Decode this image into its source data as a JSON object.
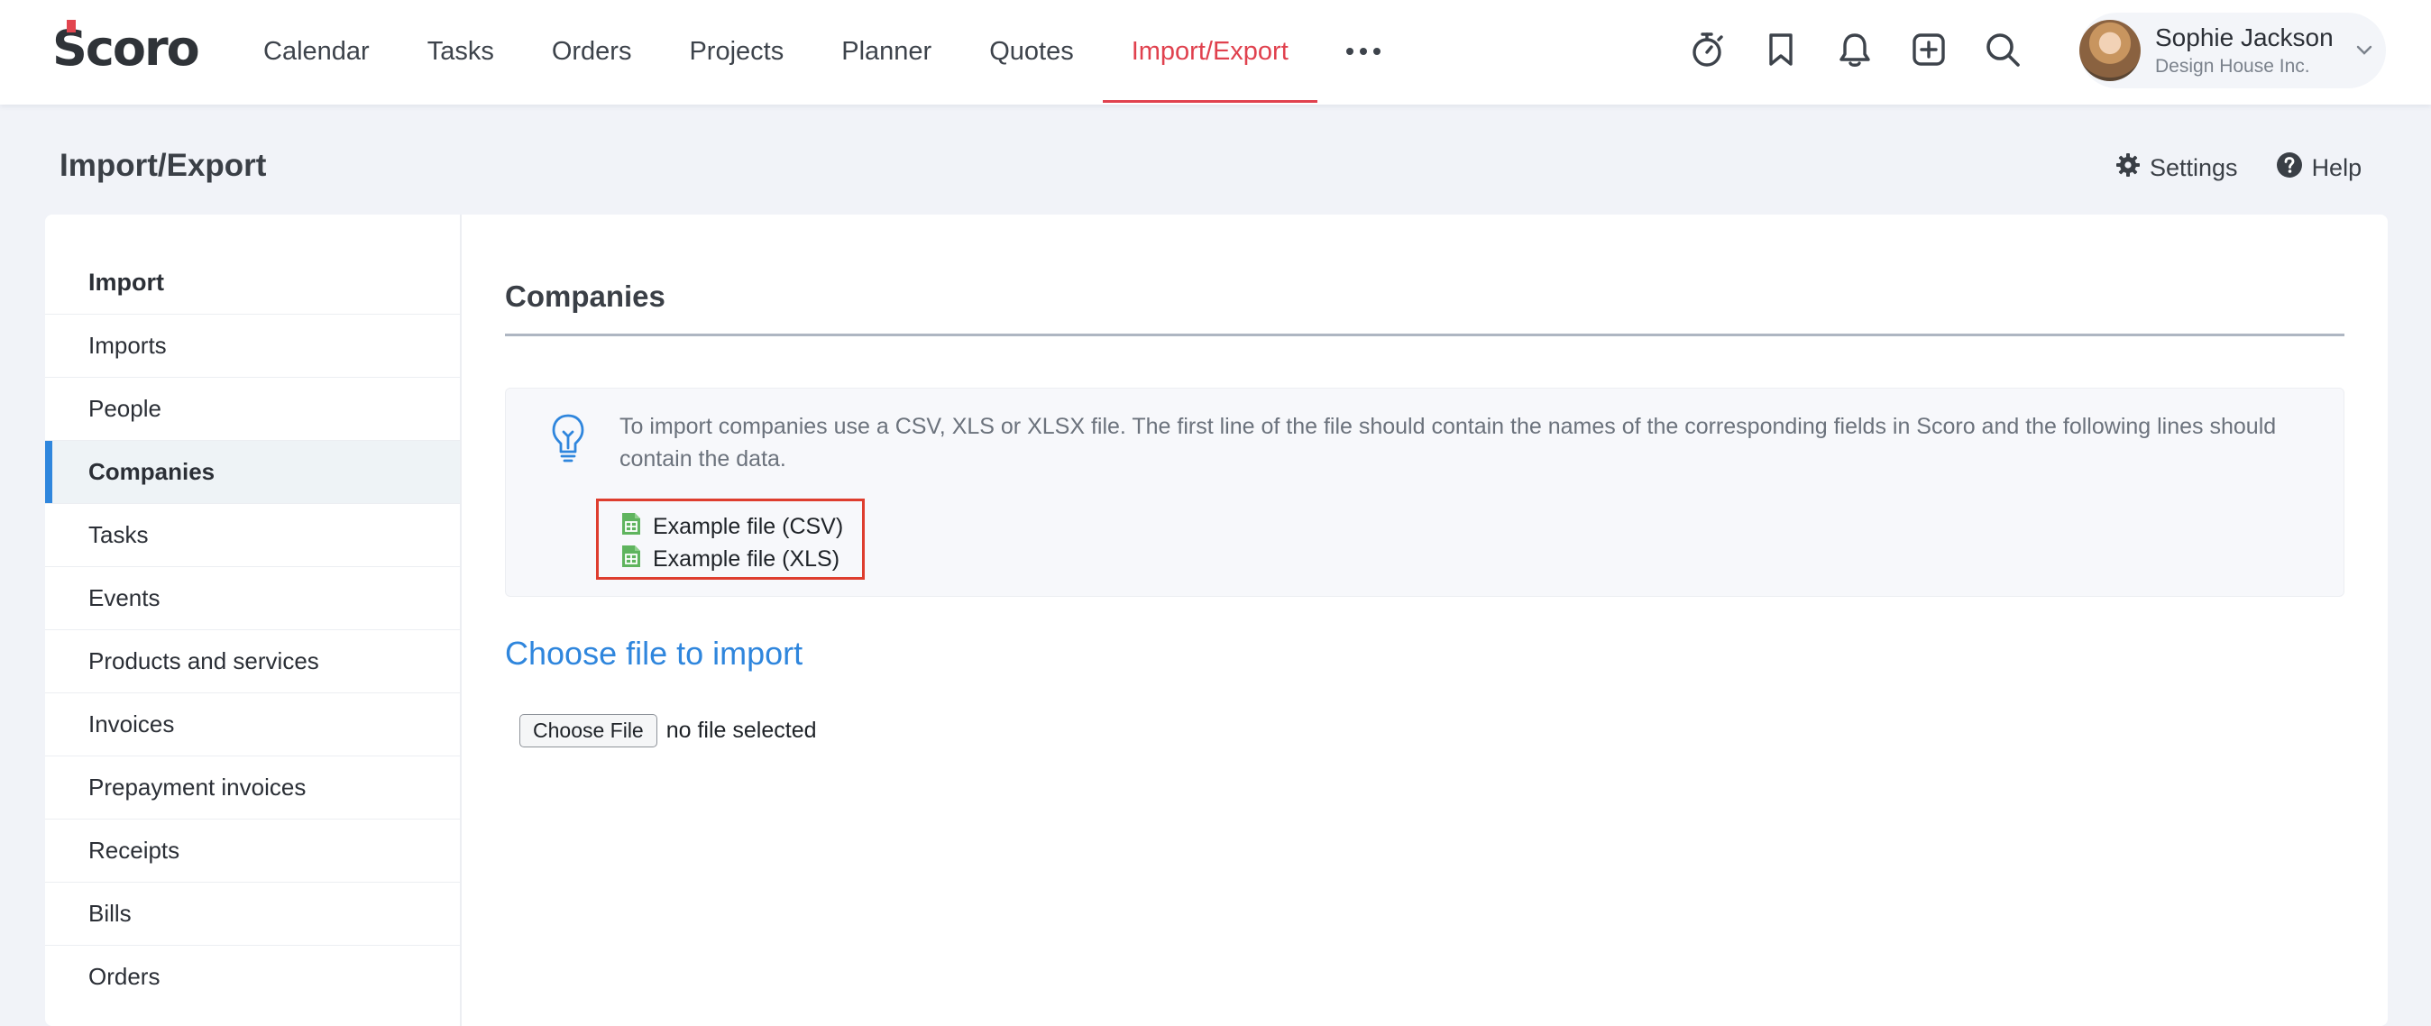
{
  "app": {
    "logo_text": "Scoro",
    "brand_color": "#e0414e",
    "accent_color": "#2f86dd"
  },
  "nav": {
    "items": [
      {
        "label": "Calendar"
      },
      {
        "label": "Tasks"
      },
      {
        "label": "Orders"
      },
      {
        "label": "Projects"
      },
      {
        "label": "Planner"
      },
      {
        "label": "Quotes"
      },
      {
        "label": "Import/Export",
        "active": true
      }
    ],
    "more_icon": "more-horizontal-icon"
  },
  "toolbar_icons": [
    "timer-icon",
    "bookmark-icon",
    "bell-icon",
    "add-square-icon",
    "search-icon"
  ],
  "user": {
    "name": "Sophie Jackson",
    "company": "Design House Inc."
  },
  "page": {
    "title": "Import/Export",
    "settings_label": "Settings",
    "help_label": "Help"
  },
  "sidebar": {
    "heading": "Import",
    "items": [
      {
        "label": "Imports"
      },
      {
        "label": "People"
      },
      {
        "label": "Companies",
        "active": true
      },
      {
        "label": "Tasks"
      },
      {
        "label": "Events"
      },
      {
        "label": "Products and services"
      },
      {
        "label": "Invoices"
      },
      {
        "label": "Prepayment invoices"
      },
      {
        "label": "Receipts"
      },
      {
        "label": "Bills"
      },
      {
        "label": "Orders"
      }
    ]
  },
  "main": {
    "section_title": "Companies",
    "info_text": "To import companies use a CSV, XLS or XLSX file. The first line of the file should contain the names of the corresponding fields in Scoro and the following lines should contain the data.",
    "example_csv": "Example file (CSV)",
    "example_xls": "Example file (XLS)",
    "choose_title": "Choose file to import",
    "file_button": "Choose File",
    "file_status": "no file selected"
  }
}
